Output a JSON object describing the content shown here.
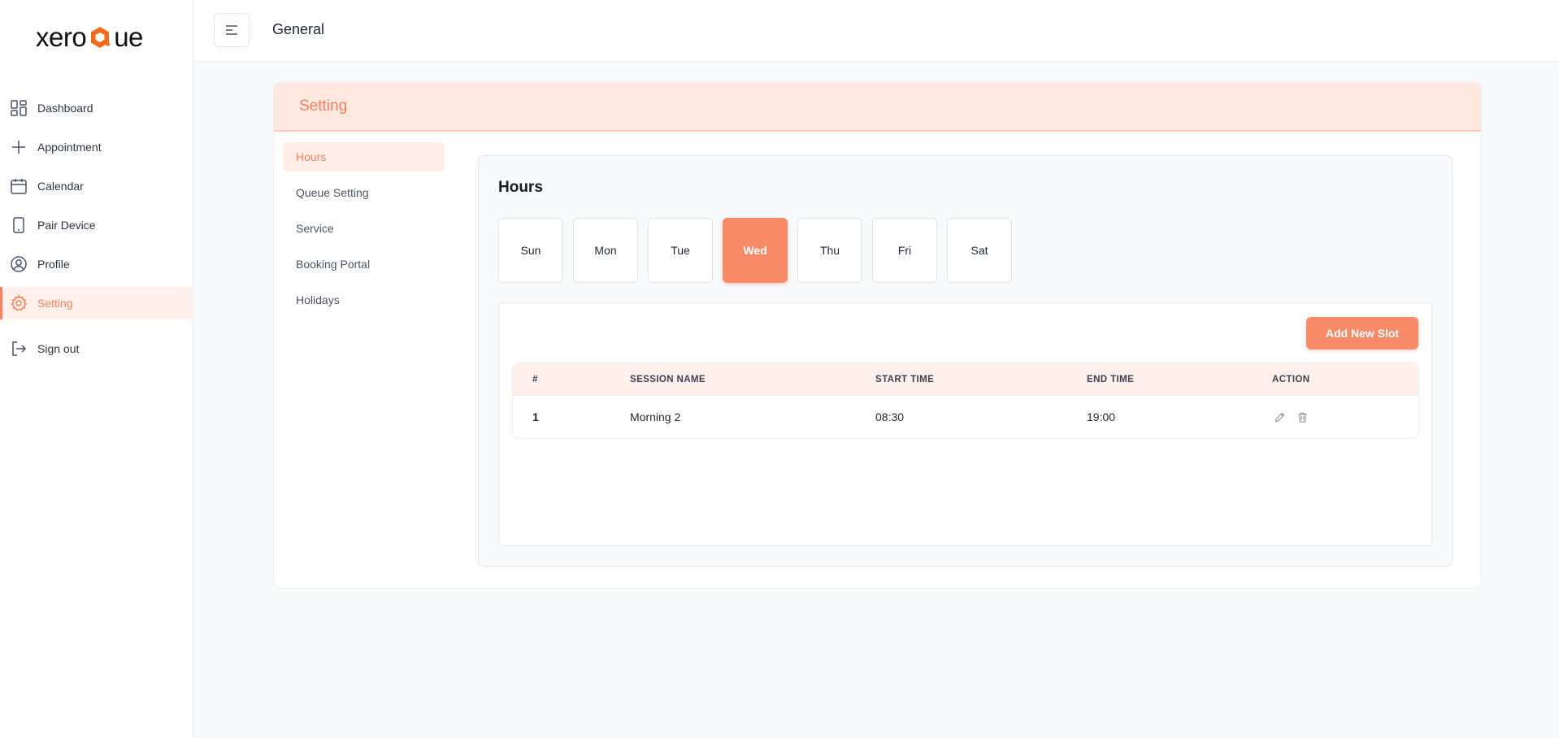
{
  "brand": {
    "part1": "xero",
    "part2": "ue",
    "accent": "#f5825d"
  },
  "sidebar": {
    "items": [
      {
        "label": "Dashboard",
        "icon": "dashboard-icon"
      },
      {
        "label": "Appointment",
        "icon": "plus-icon"
      },
      {
        "label": "Calendar",
        "icon": "calendar-icon"
      },
      {
        "label": "Pair Device",
        "icon": "device-icon"
      },
      {
        "label": "Profile",
        "icon": "user-circle-icon"
      },
      {
        "label": "Setting",
        "icon": "gear-icon",
        "active": true
      }
    ],
    "signout": {
      "label": "Sign out",
      "icon": "sign-out-icon"
    }
  },
  "topbar": {
    "title": "General"
  },
  "settings": {
    "title": "Setting",
    "subnav": [
      "Hours",
      "Queue Setting",
      "Service",
      "Booking Portal",
      "Holidays"
    ],
    "active_subnav": "Hours"
  },
  "hours": {
    "title": "Hours",
    "days": [
      "Sun",
      "Mon",
      "Tue",
      "Wed",
      "Thu",
      "Fri",
      "Sat"
    ],
    "active_day": "Wed",
    "add_button": "Add New Slot",
    "columns": [
      "#",
      "SESSION NAME",
      "START TIME",
      "END TIME",
      "ACTION"
    ],
    "rows": [
      {
        "num": "1",
        "session": "Morning 2",
        "start": "08:30",
        "end": "19:00"
      }
    ]
  }
}
